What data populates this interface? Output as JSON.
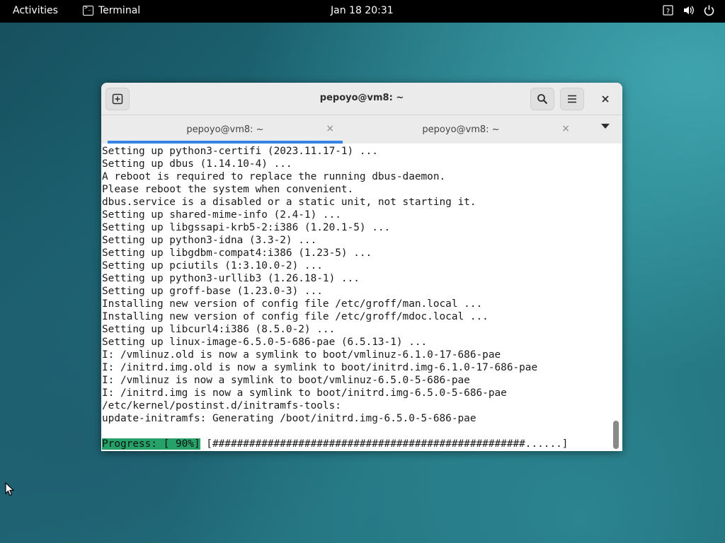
{
  "topbar": {
    "activities": "Activities",
    "app_name": "Terminal",
    "clock": "Jan 18  20:31",
    "tray_icons": [
      "network-icon",
      "volume-icon",
      "power-icon"
    ]
  },
  "window": {
    "title": "pepoyo@vm8: ~",
    "tabs": [
      {
        "label": "pepoyo@vm8: ~",
        "active": true
      },
      {
        "label": "pepoyo@vm8: ~",
        "active": false
      }
    ]
  },
  "terminal": {
    "lines": [
      "Setting up python3-certifi (2023.11.17-1) ...",
      "Setting up dbus (1.14.10-4) ...",
      "A reboot is required to replace the running dbus-daemon.",
      "Please reboot the system when convenient.",
      "dbus.service is a disabled or a static unit, not starting it.",
      "Setting up shared-mime-info (2.4-1) ...",
      "Setting up libgssapi-krb5-2:i386 (1.20.1-5) ...",
      "Setting up python3-idna (3.3-2) ...",
      "Setting up libgdbm-compat4:i386 (1.23-5) ...",
      "Setting up pciutils (1:3.10.0-2) ...",
      "Setting up python3-urllib3 (1.26.18-1) ...",
      "Setting up groff-base (1.23.0-3) ...",
      "Installing new version of config file /etc/groff/man.local ...",
      "Installing new version of config file /etc/groff/mdoc.local ...",
      "Setting up libcurl4:i386 (8.5.0-2) ...",
      "Setting up linux-image-6.5.0-5-686-pae (6.5.13-1) ...",
      "I: /vmlinuz.old is now a symlink to boot/vmlinuz-6.1.0-17-686-pae",
      "I: /initrd.img.old is now a symlink to boot/initrd.img-6.1.0-17-686-pae",
      "I: /vmlinuz is now a symlink to boot/vmlinuz-6.5.0-5-686-pae",
      "I: /initrd.img is now a symlink to boot/initrd.img-6.5.0-5-686-pae",
      "/etc/kernel/postinst.d/initramfs-tools:",
      "update-initramfs: Generating /boot/initrd.img-6.5.0-5-686-pae"
    ],
    "progress_label": "Progress: [ 90%]",
    "progress_bar": " [###################################################......]",
    "progress_value": 0.9
  },
  "colors": {
    "progress_bg": "#26a269",
    "tab_indicator": "#3584e4",
    "topbar_bg": "#000000"
  }
}
